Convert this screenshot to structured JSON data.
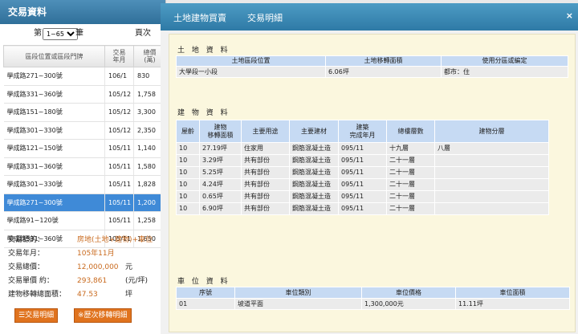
{
  "left": {
    "title": "交易資料",
    "pager": {
      "prefix": "第",
      "selected": "1~65",
      "suffix": "筆",
      "next": "頁次"
    },
    "headers": [
      "區段位置或區段門牌",
      "交易\n年月",
      "總價\n(萬)"
    ],
    "rows": [
      {
        "addr": "學成路271~300號",
        "ym": "106/1",
        "price": "830"
      },
      {
        "addr": "學成路331~360號",
        "ym": "105/12",
        "price": "1,758"
      },
      {
        "addr": "學成路151~180號",
        "ym": "105/12",
        "price": "3,300"
      },
      {
        "addr": "學成路301~330號",
        "ym": "105/12",
        "price": "2,350"
      },
      {
        "addr": "學成路121~150號",
        "ym": "105/11",
        "price": "1,140"
      },
      {
        "addr": "學成路331~360號",
        "ym": "105/11",
        "price": "1,580"
      },
      {
        "addr": "學成路301~330號",
        "ym": "105/11",
        "price": "1,828"
      },
      {
        "addr": "學成路271~300號",
        "ym": "105/11",
        "price": "1,200"
      },
      {
        "addr": "學成路91~120號",
        "ym": "105/11",
        "price": "1,258"
      },
      {
        "addr": "學成路331~360號",
        "ym": "105/11",
        "price": "1,650"
      }
    ],
    "summary": [
      {
        "k": "交易標的：",
        "v": "房地(土地+建物)+車位",
        "u": ""
      },
      {
        "k": "交易年月：",
        "v": "105年11月",
        "u": ""
      },
      {
        "k": "交易總價：",
        "v": "12,000,000",
        "u": "元"
      },
      {
        "k": "交易單價 約：",
        "v": "293,861",
        "u": "(元/坪)"
      },
      {
        "k": "建物移轉總面積：",
        "v": "47.53",
        "u": "坪"
      }
    ],
    "btn_detail": "☰交易明細",
    "btn_history": "※歷次移轉明細"
  },
  "modal": {
    "tab1": "土地建物買賣",
    "tab2": "交易明細",
    "close": "×",
    "land": {
      "title": "土 地 資 料",
      "headers": [
        "土地區段位置",
        "土地移轉面積",
        "使用分區或編定"
      ],
      "rows": [
        [
          "大學段一小段",
          "6.06坪",
          "都市：住"
        ]
      ]
    },
    "building": {
      "title": "建 物 資 料",
      "headers": [
        "屋齡",
        "建物\n移轉面積",
        "主要用途",
        "主要建材",
        "建築\n完成年月",
        "總樓層數",
        "建物分層"
      ],
      "rows": [
        [
          "10",
          "27.19坪",
          "住家用",
          "鋼筋混凝土造",
          "095/11",
          "十九層",
          "八層"
        ],
        [
          "10",
          "3.29坪",
          "共有部份",
          "鋼筋混凝土造",
          "095/11",
          "二十一層",
          ""
        ],
        [
          "10",
          "5.25坪",
          "共有部份",
          "鋼筋混凝土造",
          "095/11",
          "二十一層",
          ""
        ],
        [
          "10",
          "4.24坪",
          "共有部份",
          "鋼筋混凝土造",
          "095/11",
          "二十一層",
          ""
        ],
        [
          "10",
          "0.65坪",
          "共有部份",
          "鋼筋混凝土造",
          "095/11",
          "二十一層",
          ""
        ],
        [
          "10",
          "6.90坪",
          "共有部份",
          "鋼筋混凝土造",
          "095/11",
          "二十一層",
          ""
        ]
      ]
    },
    "parking": {
      "title": "車 位 資 料",
      "headers": [
        "序號",
        "車位類別",
        "車位價格",
        "車位面積"
      ],
      "rows": [
        [
          "01",
          "坡道平面",
          "1,300,000元",
          "11.11坪"
        ]
      ]
    }
  }
}
